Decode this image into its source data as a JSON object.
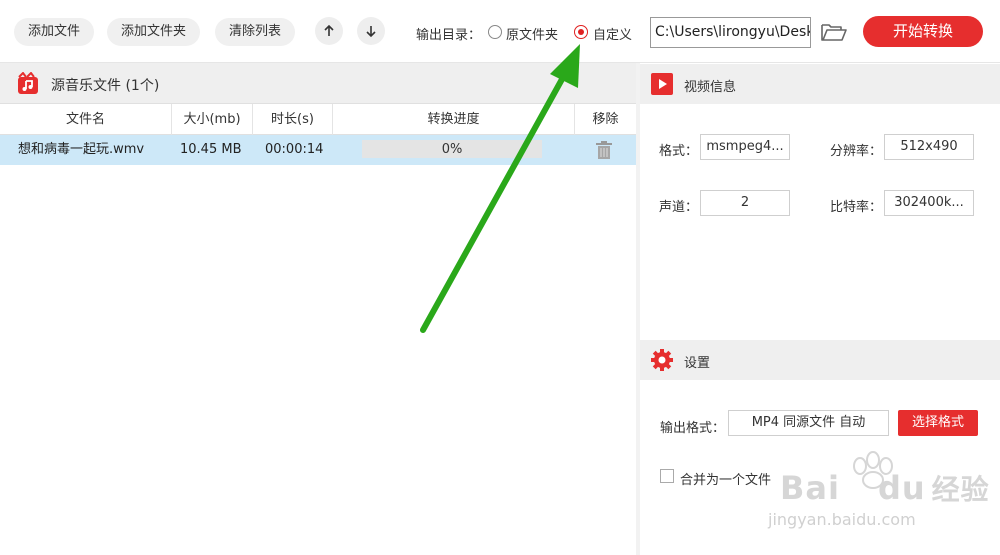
{
  "toolbar": {
    "add_file": "添加文件",
    "add_folder": "添加文件夹",
    "clear_list": "清除列表",
    "output_dir_label": "输出目录：",
    "radio_original": "原文件夹",
    "radio_custom": "自定义",
    "selected_option": "自定义",
    "output_path": "C:\\Users\\lirongyu\\Desk",
    "start_button": "开始转换",
    "accent_color": "#e62e2e"
  },
  "file_list": {
    "title": "源音乐文件 (1个)",
    "columns": [
      "文件名",
      "大小(mb)",
      "时长(s)",
      "转换进度",
      "移除"
    ],
    "rows": [
      {
        "name": "想和病毒一起玩.wmv",
        "size": "10.45 MB",
        "duration": "00:00:14",
        "progress": "0%",
        "progress_value": 0
      }
    ],
    "selected_row_color": "#cde8f8"
  },
  "video_info": {
    "title": "视频信息",
    "format_label": "格式：",
    "format_value": "msmpeg4...",
    "resolution_label": "分辨率：",
    "resolution_value": "512x490",
    "channels_label": "声道：",
    "channels_value": "2",
    "bitrate_label": "比特率：",
    "bitrate_value": "302400k..."
  },
  "settings": {
    "title": "设置",
    "output_format_label": "输出格式：",
    "output_format_value": "MP4 同源文件 自动",
    "choose_format_button": "选择格式",
    "merge_label": "合并为一个文件",
    "merge_checked": false
  },
  "watermark": {
    "brand": "Bai",
    "brand_tail": "du",
    "brand_cn": "经验",
    "url": "jingyan.baidu.com"
  },
  "icons": [
    "arrow-up-icon",
    "arrow-down-icon",
    "folder-open-icon",
    "music-file-icon",
    "trash-icon",
    "video-play-icon",
    "gear-icon",
    "green-arrow-annotation"
  ]
}
